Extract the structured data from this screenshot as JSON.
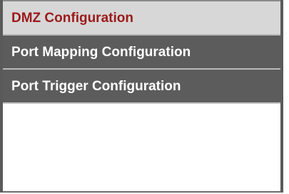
{
  "menu": {
    "items": [
      {
        "label": "DMZ Configuration",
        "state": "active"
      },
      {
        "label": "Port Mapping Configuration",
        "state": "normal"
      },
      {
        "label": "Port Trigger Configuration",
        "state": "normal"
      }
    ]
  },
  "colors": {
    "active_bg": "#d7d7d7",
    "active_text": "#9b1b1b",
    "normal_bg": "#5c5c5c",
    "normal_text": "#ffffff",
    "frame": "#5a5a5a"
  }
}
